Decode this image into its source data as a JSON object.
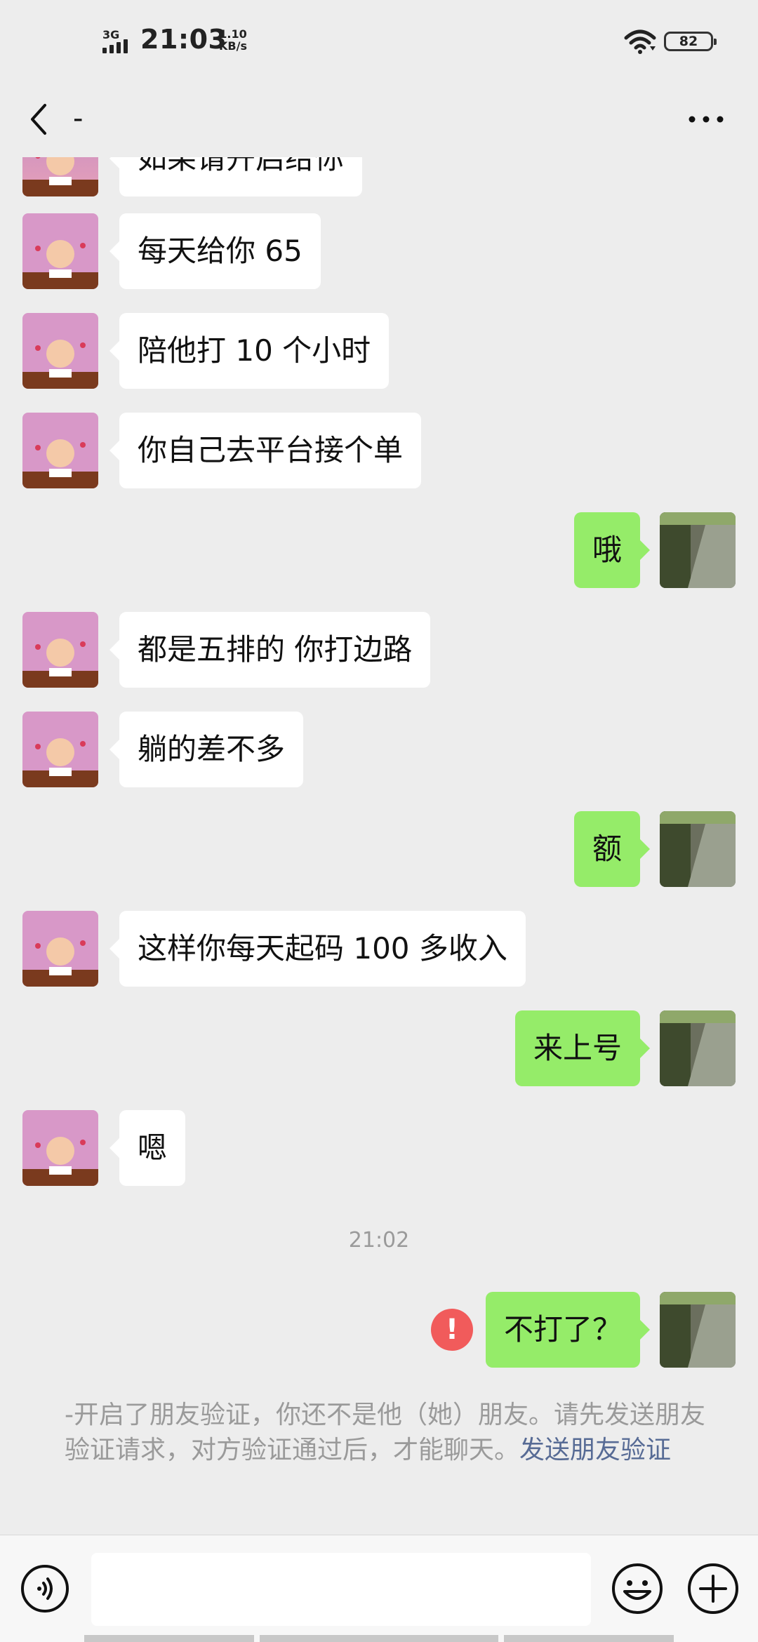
{
  "status_bar": {
    "network": "3G",
    "time": "21:03",
    "speed_value": "1.10",
    "speed_unit": "KB/s",
    "battery": "82"
  },
  "nav": {
    "title": "-",
    "back_icon": "chevron-left-icon",
    "more_icon": "more-dots-icon"
  },
  "messages": [
    {
      "side": "in",
      "text": "如果请开启给你"
    },
    {
      "side": "in",
      "text": "每天给你 65"
    },
    {
      "side": "in",
      "text": "陪他打 10 个小时"
    },
    {
      "side": "in",
      "text": "你自己去平台接个单"
    },
    {
      "side": "out",
      "text": "哦"
    },
    {
      "side": "in",
      "text": "都是五排的 你打边路"
    },
    {
      "side": "in",
      "text": "躺的差不多"
    },
    {
      "side": "out",
      "text": "额"
    },
    {
      "side": "in",
      "text": "这样你每天起码 100 多收入"
    },
    {
      "side": "out",
      "text": "来上号"
    },
    {
      "side": "in",
      "text": "嗯"
    }
  ],
  "time_label": "21:02",
  "last_message": {
    "side": "out",
    "text": "不打了？",
    "failed": true,
    "fail_symbol": "!"
  },
  "system_notice": {
    "text": "-开启了朋友验证，你还不是他（她）朋友。请先发送朋友验证请求，对方验证通过后，才能聊天。",
    "link": "发送朋友验证"
  },
  "input_bar": {
    "voice_icon": "voice-icon",
    "emoji_icon": "emoji-icon",
    "plus_icon": "plus-icon",
    "input_value": ""
  },
  "colors": {
    "background": "#ededed",
    "bubble_out": "#95ec69",
    "bubble_in": "#ffffff",
    "link": "#576b95",
    "error": "#f15b5b"
  }
}
